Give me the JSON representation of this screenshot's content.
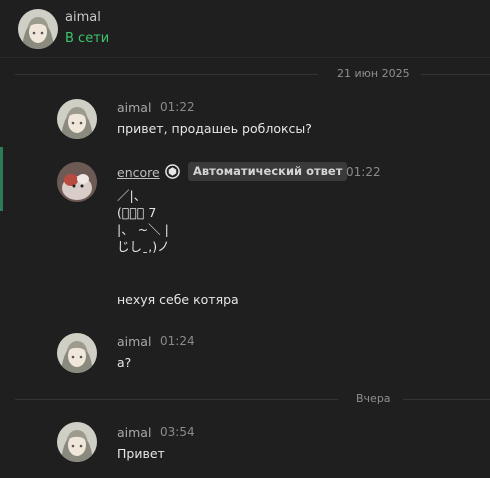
{
  "header": {
    "name": "aimal",
    "status": "В сети"
  },
  "dividers": {
    "date1": "21 июн 2025",
    "date2": "Вчера"
  },
  "messages": [
    {
      "user": "aimal",
      "time": "01:22",
      "text": "привет, продашеь роблоксы?"
    },
    {
      "user": "encore",
      "badge": "Автоматический ответ",
      "time": "01:22",
      "art": "／|、\n(ﾟ、。 7\n|、 ~＼ |\nじしˍ,)ノ",
      "text": "нехуя себе котяра"
    },
    {
      "user": "aimal",
      "time": "01:24",
      "text": "а?"
    },
    {
      "user": "aimal",
      "time": "03:54",
      "text": "Привет"
    }
  ],
  "colors": {
    "background": "#1f1f1f",
    "status_online": "#3ec46d",
    "highlight": "#2f7a57"
  }
}
